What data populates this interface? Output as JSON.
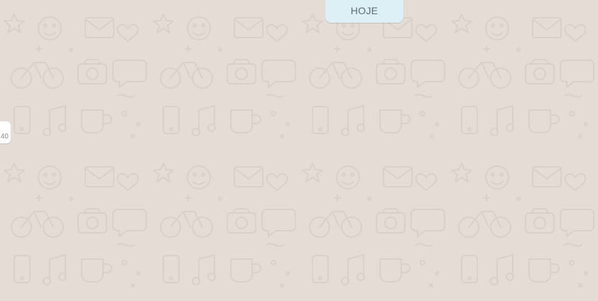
{
  "chat": {
    "background_color": "#e5ddd5",
    "wallpaper_icon": "doodle-pattern"
  },
  "date_divider": {
    "label": "HOJE"
  },
  "message": {
    "time": "40"
  }
}
